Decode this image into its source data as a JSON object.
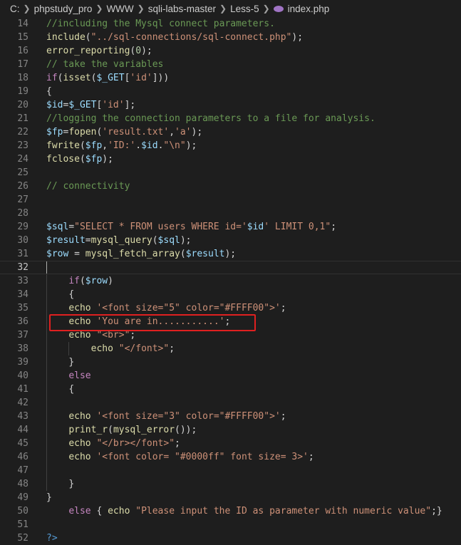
{
  "breadcrumb": {
    "segments": [
      "C:",
      "phpstudy_pro",
      "WWW",
      "sqli-labs-master",
      "Less-5"
    ],
    "file_icon": "php-icon",
    "file": "index.php"
  },
  "editor": {
    "active_line": 32,
    "lines": [
      {
        "n": 14,
        "indent": 0,
        "tokens": [
          [
            "cmt",
            "//including the Mysql connect parameters."
          ]
        ]
      },
      {
        "n": 15,
        "indent": 0,
        "tokens": [
          [
            "fn",
            "include"
          ],
          [
            "punc",
            "("
          ],
          [
            "str",
            "\"../sql-connections/sql-connect.php\""
          ],
          [
            "punc",
            ");"
          ]
        ]
      },
      {
        "n": 16,
        "indent": 0,
        "tokens": [
          [
            "fn",
            "error_reporting"
          ],
          [
            "punc",
            "("
          ],
          [
            "num",
            "0"
          ],
          [
            "punc",
            ");"
          ]
        ]
      },
      {
        "n": 17,
        "indent": 0,
        "tokens": [
          [
            "cmt",
            "// take the variables"
          ]
        ]
      },
      {
        "n": 18,
        "indent": 0,
        "tokens": [
          [
            "kw",
            "if"
          ],
          [
            "punc",
            "("
          ],
          [
            "fn",
            "isset"
          ],
          [
            "punc",
            "("
          ],
          [
            "var",
            "$_GET"
          ],
          [
            "punc",
            "["
          ],
          [
            "str",
            "'id'"
          ],
          [
            "punc",
            "]))"
          ]
        ]
      },
      {
        "n": 19,
        "indent": 0,
        "tokens": [
          [
            "punc",
            "{"
          ]
        ]
      },
      {
        "n": 20,
        "indent": 0,
        "tokens": [
          [
            "var",
            "$id"
          ],
          [
            "punc",
            "="
          ],
          [
            "var",
            "$_GET"
          ],
          [
            "punc",
            "["
          ],
          [
            "str",
            "'id'"
          ],
          [
            "punc",
            "];"
          ]
        ]
      },
      {
        "n": 21,
        "indent": 0,
        "tokens": [
          [
            "cmt",
            "//logging the connection parameters to a file for analysis."
          ]
        ]
      },
      {
        "n": 22,
        "indent": 0,
        "tokens": [
          [
            "var",
            "$fp"
          ],
          [
            "punc",
            "="
          ],
          [
            "fn",
            "fopen"
          ],
          [
            "punc",
            "("
          ],
          [
            "str",
            "'result.txt'"
          ],
          [
            "punc",
            ","
          ],
          [
            "str",
            "'a'"
          ],
          [
            "punc",
            ");"
          ]
        ]
      },
      {
        "n": 23,
        "indent": 0,
        "tokens": [
          [
            "fn",
            "fwrite"
          ],
          [
            "punc",
            "("
          ],
          [
            "var",
            "$fp"
          ],
          [
            "punc",
            ","
          ],
          [
            "str",
            "'ID:'"
          ],
          [
            "punc",
            "."
          ],
          [
            "var",
            "$id"
          ],
          [
            "punc",
            "."
          ],
          [
            "str",
            "\"\\n\""
          ],
          [
            "punc",
            ");"
          ]
        ]
      },
      {
        "n": 24,
        "indent": 0,
        "tokens": [
          [
            "fn",
            "fclose"
          ],
          [
            "punc",
            "("
          ],
          [
            "var",
            "$fp"
          ],
          [
            "punc",
            ");"
          ]
        ]
      },
      {
        "n": 25,
        "indent": 0,
        "tokens": []
      },
      {
        "n": 26,
        "indent": 0,
        "tokens": [
          [
            "cmt",
            "// connectivity"
          ]
        ]
      },
      {
        "n": 27,
        "indent": 0,
        "tokens": []
      },
      {
        "n": 28,
        "indent": 0,
        "tokens": []
      },
      {
        "n": 29,
        "indent": 0,
        "tokens": [
          [
            "var",
            "$sql"
          ],
          [
            "punc",
            "="
          ],
          [
            "str",
            "\"SELECT * FROM users WHERE id='"
          ],
          [
            "var",
            "$id"
          ],
          [
            "str",
            "' LIMIT 0,1\""
          ],
          [
            "punc",
            ";"
          ]
        ]
      },
      {
        "n": 30,
        "indent": 0,
        "tokens": [
          [
            "var",
            "$result"
          ],
          [
            "punc",
            "="
          ],
          [
            "fn",
            "mysql_query"
          ],
          [
            "punc",
            "("
          ],
          [
            "var",
            "$sql"
          ],
          [
            "punc",
            ");"
          ]
        ]
      },
      {
        "n": 31,
        "indent": 0,
        "tokens": [
          [
            "var",
            "$row"
          ],
          [
            "punc",
            " = "
          ],
          [
            "fn",
            "mysql_fetch_array"
          ],
          [
            "punc",
            "("
          ],
          [
            "var",
            "$result"
          ],
          [
            "punc",
            ");"
          ]
        ]
      },
      {
        "n": 32,
        "indent": 0,
        "tokens": []
      },
      {
        "n": 33,
        "indent": 1,
        "tokens": [
          [
            "kw",
            "if"
          ],
          [
            "punc",
            "("
          ],
          [
            "var",
            "$row"
          ],
          [
            "punc",
            ")"
          ]
        ]
      },
      {
        "n": 34,
        "indent": 1,
        "tokens": [
          [
            "punc",
            "{"
          ]
        ]
      },
      {
        "n": 35,
        "indent": 1,
        "tokens": [
          [
            "fn",
            "echo"
          ],
          [
            "punc",
            " "
          ],
          [
            "str",
            "'<font size=\"5\" color=\"#FFFF00\">'"
          ],
          [
            "punc",
            ";"
          ]
        ]
      },
      {
        "n": 36,
        "indent": 1,
        "tokens": [
          [
            "fn",
            "echo"
          ],
          [
            "punc",
            " "
          ],
          [
            "str",
            "'You are in...........'"
          ],
          [
            "punc",
            ";"
          ]
        ]
      },
      {
        "n": 37,
        "indent": 1,
        "tokens": [
          [
            "fn",
            "echo"
          ],
          [
            "punc",
            " "
          ],
          [
            "str",
            "\"<br>\""
          ],
          [
            "punc",
            ";"
          ]
        ]
      },
      {
        "n": 38,
        "indent": 2,
        "tokens": [
          [
            "fn",
            "echo"
          ],
          [
            "punc",
            " "
          ],
          [
            "str",
            "\"</font>\""
          ],
          [
            "punc",
            ";"
          ]
        ]
      },
      {
        "n": 39,
        "indent": 1,
        "tokens": [
          [
            "punc",
            "}"
          ]
        ]
      },
      {
        "n": 40,
        "indent": 1,
        "tokens": [
          [
            "kw",
            "else"
          ]
        ]
      },
      {
        "n": 41,
        "indent": 1,
        "tokens": [
          [
            "punc",
            "{"
          ]
        ]
      },
      {
        "n": 42,
        "indent": 0,
        "tokens": []
      },
      {
        "n": 43,
        "indent": 1,
        "tokens": [
          [
            "fn",
            "echo"
          ],
          [
            "punc",
            " "
          ],
          [
            "str",
            "'<font size=\"3\" color=\"#FFFF00\">'"
          ],
          [
            "punc",
            ";"
          ]
        ]
      },
      {
        "n": 44,
        "indent": 1,
        "tokens": [
          [
            "fn",
            "print_r"
          ],
          [
            "punc",
            "("
          ],
          [
            "fn",
            "mysql_error"
          ],
          [
            "punc",
            "());"
          ]
        ]
      },
      {
        "n": 45,
        "indent": 1,
        "tokens": [
          [
            "fn",
            "echo"
          ],
          [
            "punc",
            " "
          ],
          [
            "str",
            "\"</br></font>\""
          ],
          [
            "punc",
            ";"
          ]
        ]
      },
      {
        "n": 46,
        "indent": 1,
        "tokens": [
          [
            "fn",
            "echo"
          ],
          [
            "punc",
            " "
          ],
          [
            "str",
            "'<font color= \"#0000ff\" font size= 3>'"
          ],
          [
            "punc",
            ";"
          ]
        ]
      },
      {
        "n": 47,
        "indent": 0,
        "tokens": []
      },
      {
        "n": 48,
        "indent": 1,
        "tokens": [
          [
            "punc",
            "}"
          ]
        ]
      },
      {
        "n": 49,
        "indent": 0,
        "tokens": [
          [
            "punc",
            "}"
          ]
        ]
      },
      {
        "n": 50,
        "indent": 1,
        "tokens": [
          [
            "kw",
            "else"
          ],
          [
            "punc",
            " { "
          ],
          [
            "fn",
            "echo"
          ],
          [
            "punc",
            " "
          ],
          [
            "str",
            "\"Please input the ID as parameter with numeric value\""
          ],
          [
            "punc",
            ";}"
          ]
        ]
      },
      {
        "n": 51,
        "indent": 0,
        "tokens": []
      },
      {
        "n": 52,
        "indent": 0,
        "tokens": [
          [
            "php",
            "?>"
          ]
        ]
      }
    ]
  },
  "annotation": {
    "highlight_line": 36,
    "color": "#e02020"
  },
  "colors": {
    "background": "#1e1e1e",
    "comment": "#6a9955",
    "keyword": "#c586c0",
    "function": "#dcdcaa",
    "string": "#ce9178",
    "variable": "#9cdcfe",
    "number": "#b5cea8",
    "php_tag": "#569cd6",
    "line_number": "#858585"
  }
}
